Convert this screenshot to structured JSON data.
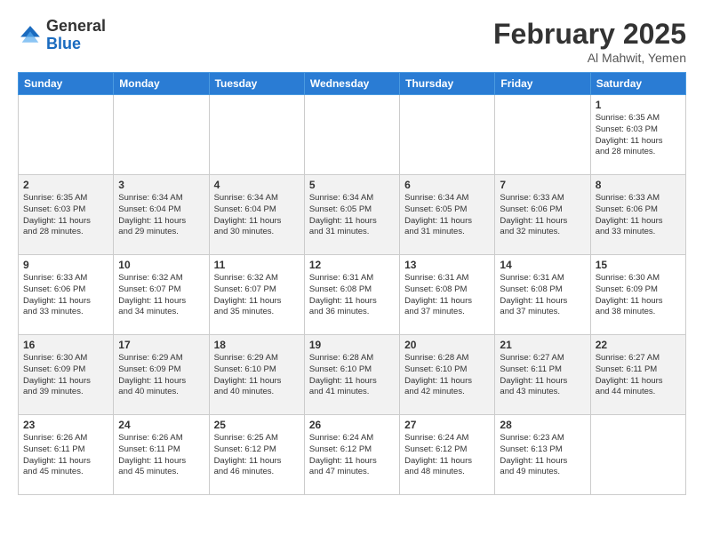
{
  "logo": {
    "general": "General",
    "blue": "Blue"
  },
  "title": "February 2025",
  "location": "Al Mahwit, Yemen",
  "weekdays": [
    "Sunday",
    "Monday",
    "Tuesday",
    "Wednesday",
    "Thursday",
    "Friday",
    "Saturday"
  ],
  "weeks": [
    [
      {
        "day": "",
        "info": ""
      },
      {
        "day": "",
        "info": ""
      },
      {
        "day": "",
        "info": ""
      },
      {
        "day": "",
        "info": ""
      },
      {
        "day": "",
        "info": ""
      },
      {
        "day": "",
        "info": ""
      },
      {
        "day": "1",
        "info": "Sunrise: 6:35 AM\nSunset: 6:03 PM\nDaylight: 11 hours\nand 28 minutes."
      }
    ],
    [
      {
        "day": "2",
        "info": "Sunrise: 6:35 AM\nSunset: 6:03 PM\nDaylight: 11 hours\nand 28 minutes."
      },
      {
        "day": "3",
        "info": "Sunrise: 6:34 AM\nSunset: 6:04 PM\nDaylight: 11 hours\nand 29 minutes."
      },
      {
        "day": "4",
        "info": "Sunrise: 6:34 AM\nSunset: 6:04 PM\nDaylight: 11 hours\nand 30 minutes."
      },
      {
        "day": "5",
        "info": "Sunrise: 6:34 AM\nSunset: 6:05 PM\nDaylight: 11 hours\nand 31 minutes."
      },
      {
        "day": "6",
        "info": "Sunrise: 6:34 AM\nSunset: 6:05 PM\nDaylight: 11 hours\nand 31 minutes."
      },
      {
        "day": "7",
        "info": "Sunrise: 6:33 AM\nSunset: 6:06 PM\nDaylight: 11 hours\nand 32 minutes."
      },
      {
        "day": "8",
        "info": "Sunrise: 6:33 AM\nSunset: 6:06 PM\nDaylight: 11 hours\nand 33 minutes."
      }
    ],
    [
      {
        "day": "9",
        "info": "Sunrise: 6:33 AM\nSunset: 6:06 PM\nDaylight: 11 hours\nand 33 minutes."
      },
      {
        "day": "10",
        "info": "Sunrise: 6:32 AM\nSunset: 6:07 PM\nDaylight: 11 hours\nand 34 minutes."
      },
      {
        "day": "11",
        "info": "Sunrise: 6:32 AM\nSunset: 6:07 PM\nDaylight: 11 hours\nand 35 minutes."
      },
      {
        "day": "12",
        "info": "Sunrise: 6:31 AM\nSunset: 6:08 PM\nDaylight: 11 hours\nand 36 minutes."
      },
      {
        "day": "13",
        "info": "Sunrise: 6:31 AM\nSunset: 6:08 PM\nDaylight: 11 hours\nand 37 minutes."
      },
      {
        "day": "14",
        "info": "Sunrise: 6:31 AM\nSunset: 6:08 PM\nDaylight: 11 hours\nand 37 minutes."
      },
      {
        "day": "15",
        "info": "Sunrise: 6:30 AM\nSunset: 6:09 PM\nDaylight: 11 hours\nand 38 minutes."
      }
    ],
    [
      {
        "day": "16",
        "info": "Sunrise: 6:30 AM\nSunset: 6:09 PM\nDaylight: 11 hours\nand 39 minutes."
      },
      {
        "day": "17",
        "info": "Sunrise: 6:29 AM\nSunset: 6:09 PM\nDaylight: 11 hours\nand 40 minutes."
      },
      {
        "day": "18",
        "info": "Sunrise: 6:29 AM\nSunset: 6:10 PM\nDaylight: 11 hours\nand 40 minutes."
      },
      {
        "day": "19",
        "info": "Sunrise: 6:28 AM\nSunset: 6:10 PM\nDaylight: 11 hours\nand 41 minutes."
      },
      {
        "day": "20",
        "info": "Sunrise: 6:28 AM\nSunset: 6:10 PM\nDaylight: 11 hours\nand 42 minutes."
      },
      {
        "day": "21",
        "info": "Sunrise: 6:27 AM\nSunset: 6:11 PM\nDaylight: 11 hours\nand 43 minutes."
      },
      {
        "day": "22",
        "info": "Sunrise: 6:27 AM\nSunset: 6:11 PM\nDaylight: 11 hours\nand 44 minutes."
      }
    ],
    [
      {
        "day": "23",
        "info": "Sunrise: 6:26 AM\nSunset: 6:11 PM\nDaylight: 11 hours\nand 45 minutes."
      },
      {
        "day": "24",
        "info": "Sunrise: 6:26 AM\nSunset: 6:11 PM\nDaylight: 11 hours\nand 45 minutes."
      },
      {
        "day": "25",
        "info": "Sunrise: 6:25 AM\nSunset: 6:12 PM\nDaylight: 11 hours\nand 46 minutes."
      },
      {
        "day": "26",
        "info": "Sunrise: 6:24 AM\nSunset: 6:12 PM\nDaylight: 11 hours\nand 47 minutes."
      },
      {
        "day": "27",
        "info": "Sunrise: 6:24 AM\nSunset: 6:12 PM\nDaylight: 11 hours\nand 48 minutes."
      },
      {
        "day": "28",
        "info": "Sunrise: 6:23 AM\nSunset: 6:13 PM\nDaylight: 11 hours\nand 49 minutes."
      },
      {
        "day": "",
        "info": ""
      }
    ]
  ],
  "row_styles": [
    "row-white",
    "row-shaded",
    "row-white",
    "row-shaded",
    "row-white"
  ]
}
